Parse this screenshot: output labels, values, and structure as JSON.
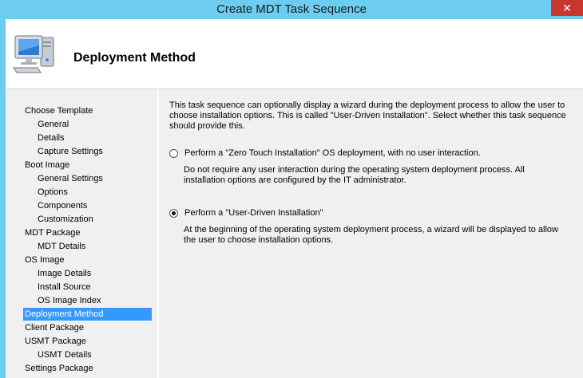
{
  "window": {
    "title": "Create MDT Task Sequence",
    "close_glyph": "✕"
  },
  "header": {
    "icon": "computer-icon",
    "title": "Deployment Method"
  },
  "sidebar": {
    "items": [
      {
        "label": "Choose Template",
        "level": 0,
        "selected": false
      },
      {
        "label": "General",
        "level": 1,
        "selected": false
      },
      {
        "label": "Details",
        "level": 1,
        "selected": false
      },
      {
        "label": "Capture Settings",
        "level": 1,
        "selected": false
      },
      {
        "label": "Boot Image",
        "level": 0,
        "selected": false
      },
      {
        "label": "General Settings",
        "level": 1,
        "selected": false
      },
      {
        "label": "Options",
        "level": 1,
        "selected": false
      },
      {
        "label": "Components",
        "level": 1,
        "selected": false
      },
      {
        "label": "Customization",
        "level": 1,
        "selected": false
      },
      {
        "label": "MDT Package",
        "level": 0,
        "selected": false
      },
      {
        "label": "MDT Details",
        "level": 1,
        "selected": false
      },
      {
        "label": "OS Image",
        "level": 0,
        "selected": false
      },
      {
        "label": "Image Details",
        "level": 1,
        "selected": false
      },
      {
        "label": "Install Source",
        "level": 1,
        "selected": false
      },
      {
        "label": "OS Image Index",
        "level": 1,
        "selected": false
      },
      {
        "label": "Deployment Method",
        "level": 0,
        "selected": true
      },
      {
        "label": "Client Package",
        "level": 0,
        "selected": false
      },
      {
        "label": "USMT Package",
        "level": 0,
        "selected": false
      },
      {
        "label": "USMT Details",
        "level": 1,
        "selected": false
      },
      {
        "label": "Settings Package",
        "level": 0,
        "selected": false
      }
    ]
  },
  "content": {
    "intro": "This task sequence can optionally display a wizard during the deployment process to allow the user to choose installation options.  This is called \"User-Driven Installation\".  Select whether this task sequence should provide this.",
    "options": [
      {
        "label": "Perform a \"Zero Touch Installation\" OS deployment, with no user interaction.",
        "description": "Do not require any user interaction during the operating system deployment process.  All installation options are configured by the IT administrator.",
        "selected": false
      },
      {
        "label": "Perform a \"User-Driven Installation\"",
        "description": "At the beginning of the operating system deployment process, a wizard will be displayed to allow the user to choose installation options.",
        "selected": true
      }
    ]
  }
}
